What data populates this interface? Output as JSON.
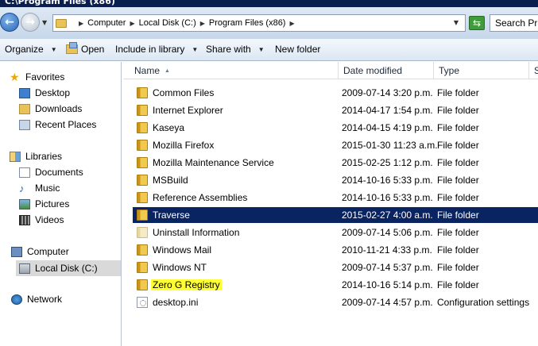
{
  "window": {
    "title": "C:\\Program Files (x86)"
  },
  "address": {
    "crumbs": [
      "Computer",
      "Local Disk (C:)",
      "Program Files (x86)"
    ],
    "search_placeholder": "Search Prog"
  },
  "toolbar": {
    "organize": "Organize",
    "open": "Open",
    "include_in_library": "Include in library",
    "share_with": "Share with",
    "new_folder": "New folder"
  },
  "nav": {
    "favorites": "Favorites",
    "desktop": "Desktop",
    "downloads": "Downloads",
    "recent_places": "Recent Places",
    "libraries": "Libraries",
    "documents": "Documents",
    "music": "Music",
    "pictures": "Pictures",
    "videos": "Videos",
    "computer": "Computer",
    "local_disk": "Local Disk (C:)",
    "network": "Network"
  },
  "columns": {
    "name": "Name",
    "date_modified": "Date modified",
    "type": "Type",
    "size": "Si"
  },
  "files": [
    {
      "name": "Common Files",
      "date": "2009-07-14 3:20 p.m.",
      "type": "File folder",
      "icon": "folder-icon"
    },
    {
      "name": "Internet Explorer",
      "date": "2014-04-17 1:54 p.m.",
      "type": "File folder",
      "icon": "folder-icon"
    },
    {
      "name": "Kaseya",
      "date": "2014-04-15 4:19 p.m.",
      "type": "File folder",
      "icon": "folder-icon"
    },
    {
      "name": "Mozilla Firefox",
      "date": "2015-01-30 11:23 a.m.",
      "type": "File folder",
      "icon": "folder-icon"
    },
    {
      "name": "Mozilla Maintenance Service",
      "date": "2015-02-25 1:12 p.m.",
      "type": "File folder",
      "icon": "folder-icon"
    },
    {
      "name": "MSBuild",
      "date": "2014-10-16 5:33 p.m.",
      "type": "File folder",
      "icon": "folder-icon"
    },
    {
      "name": "Reference Assemblies",
      "date": "2014-10-16 5:33 p.m.",
      "type": "File folder",
      "icon": "folder-icon"
    },
    {
      "name": "Traverse",
      "date": "2015-02-27 4:00 a.m.",
      "type": "File folder",
      "icon": "folder-icon"
    },
    {
      "name": "Uninstall Information",
      "date": "2009-07-14 5:06 p.m.",
      "type": "File folder",
      "icon": "folder-icon"
    },
    {
      "name": "Windows Mail",
      "date": "2010-11-21 4:33 p.m.",
      "type": "File folder",
      "icon": "folder-icon"
    },
    {
      "name": "Windows NT",
      "date": "2009-07-14 5:37 p.m.",
      "type": "File folder",
      "icon": "folder-icon"
    },
    {
      "name": "Zero G Registry",
      "date": "2014-10-16 5:14 p.m.",
      "type": "File folder",
      "icon": "folder-icon"
    },
    {
      "name": "desktop.ini",
      "date": "2009-07-14 4:57 p.m.",
      "type": "Configuration settings",
      "icon": "settings-file-icon"
    }
  ],
  "selected_row": "Traverse",
  "highlighted_row": "Zero G Registry",
  "colors": {
    "selection": "#0a2461",
    "highlight": "#ffff33",
    "title_bar": "#0a1f4d"
  }
}
